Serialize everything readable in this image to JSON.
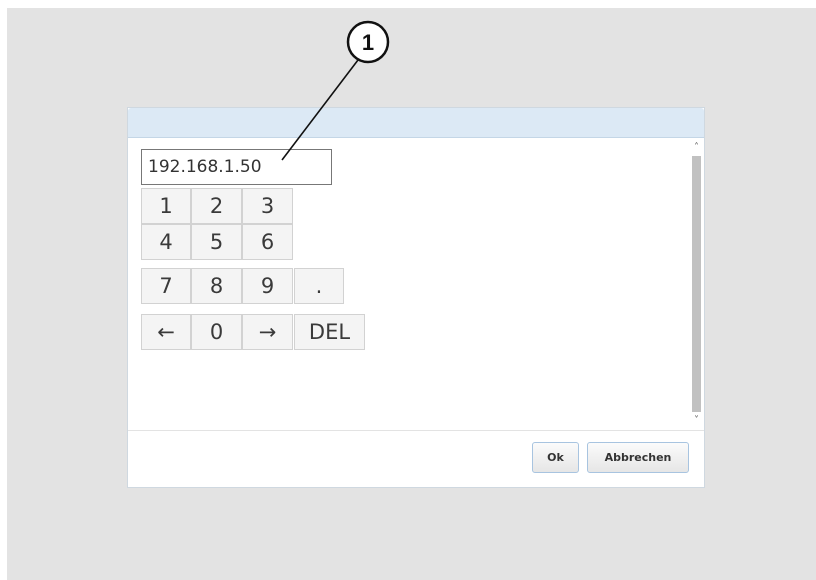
{
  "callout": {
    "number": "1"
  },
  "dialog": {
    "ip_value": "192.168.1.50",
    "keypad": {
      "k1": "1",
      "k2": "2",
      "k3": "3",
      "k4": "4",
      "k5": "5",
      "k6": "6",
      "k7": "7",
      "k8": "8",
      "k9": "9",
      "kdot": ".",
      "kleft": "←",
      "k0": "0",
      "kright": "→",
      "kdel": "DEL"
    },
    "scroll_up": "˄",
    "scroll_down": "˅",
    "ok_label": "Ok",
    "cancel_label": "Abbrechen"
  },
  "colors": {
    "header": "#dce9f5",
    "backdrop": "#e3e3e3",
    "button_border": "#a8c4e0"
  }
}
